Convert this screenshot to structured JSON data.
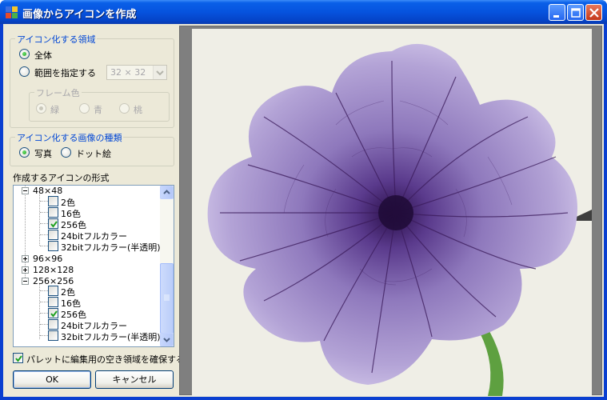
{
  "window": {
    "title": "画像からアイコンを作成",
    "title_buttons": [
      "minimize-icon",
      "maximize-icon",
      "close-icon"
    ]
  },
  "area_group": {
    "legend": "アイコン化する領域",
    "options": [
      "全体",
      "範囲を指定する"
    ],
    "selected": "全体",
    "size_combo": {
      "value": "32 × 32",
      "enabled": false
    },
    "frame_color": {
      "legend": "フレーム色",
      "options": [
        "緑",
        "青",
        "桃"
      ],
      "selected": "緑",
      "enabled": false
    }
  },
  "kind_group": {
    "legend": "アイコン化する画像の種類",
    "options": [
      "写真",
      "ドット絵"
    ],
    "selected": "写真"
  },
  "format_label": "作成するアイコンの形式",
  "format_tree": [
    {
      "label": "48×48",
      "expanded": true,
      "children": [
        {
          "label": "2色",
          "checked": false
        },
        {
          "label": "16色",
          "checked": false
        },
        {
          "label": "256色",
          "checked": true
        },
        {
          "label": "24bitフルカラー",
          "checked": false
        },
        {
          "label": "32bitフルカラー(半透明)",
          "checked": false
        }
      ]
    },
    {
      "label": "96×96",
      "expanded": false
    },
    {
      "label": "128×128",
      "expanded": false
    },
    {
      "label": "256×256",
      "expanded": true,
      "children": [
        {
          "label": "2色",
          "checked": false
        },
        {
          "label": "16色",
          "checked": false
        },
        {
          "label": "256色",
          "checked": true
        },
        {
          "label": "24bitフルカラー",
          "checked": false
        },
        {
          "label": "32bitフルカラー(半透明)",
          "checked": false
        }
      ]
    }
  ],
  "palette_checkbox": {
    "label": "パレットに編集用の空き領域を確保する",
    "checked": true
  },
  "buttons": {
    "ok": "OK",
    "cancel": "キャンセル"
  },
  "colors": {
    "title_bar": "#0653de",
    "dialog_bg": "#ece9d8",
    "group_legend": "#0046d5",
    "preview_bg": "#7f7f7f",
    "petal": "#9a86c4",
    "vein": "#3a1a5a"
  }
}
